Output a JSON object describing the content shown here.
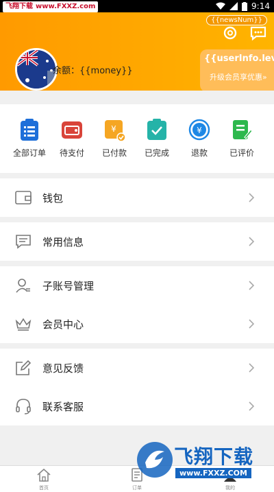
{
  "status_bar": {
    "watermark_site": "飞翔下载",
    "watermark_domain": "www.FXXZ.com",
    "time": "9:14"
  },
  "header": {
    "news_badge": "{{newsNum}}",
    "balance": "余额：{{money}}",
    "level": "{{userInfo.level}}",
    "upgrade_text": "升级会员享优惠»"
  },
  "orders": [
    {
      "label": "全部订单",
      "icon": "clipboard-list-icon",
      "color": "#1e6fd9"
    },
    {
      "label": "待支付",
      "icon": "wallet-icon",
      "color": "#d9443a"
    },
    {
      "label": "已付款",
      "icon": "yen-check-icon",
      "color": "#f5a623"
    },
    {
      "label": "已完成",
      "icon": "check-box-icon",
      "color": "#25b3a8"
    },
    {
      "label": "退款",
      "icon": "refund-icon",
      "color": "#1e88e5"
    },
    {
      "label": "已评价",
      "icon": "edit-doc-icon",
      "color": "#2db84d"
    }
  ],
  "menu": {
    "wallet": "钱包",
    "common_info": "常用信息",
    "sub_account": "子账号管理",
    "member_center": "会员中心",
    "feedback": "意见反馈",
    "customer_service": "联系客服"
  },
  "tabbar": {
    "home": "首页",
    "orders": "订单",
    "mine": "我的"
  },
  "watermark": {
    "brand": "飞翔下载",
    "url": "www.FXXZ.COM"
  },
  "colors": {
    "header_orange": "#ff9a00",
    "level_card": "#ffbd59",
    "brand_blue": "#1565c0"
  }
}
